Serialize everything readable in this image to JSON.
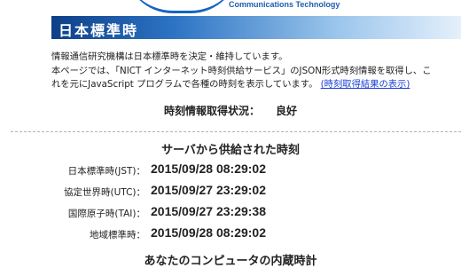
{
  "header": {
    "logo_subtext": "Communications Technology",
    "banner_title": "日本標準時"
  },
  "intro": {
    "line1": "情報通信研究機構は日本標準時を決定・維持しています。",
    "line2": "本ページでは、「NICT インターネット時刻供給サービス」のJSON形式時刻情報を取得し、こ",
    "line3_text": "れを元にJavaScript プログラムで各種の時刻を表示しています。",
    "link_label": "(時刻取得結果の表示)"
  },
  "status": {
    "label": "時刻情報取得状況：",
    "value": "良好"
  },
  "server_section": {
    "title": "サーバから供給された時刻",
    "rows": [
      {
        "label": "日本標準時(JST)：",
        "value": "2015/09/28 08:29:02"
      },
      {
        "label": "協定世界時(UTC)：",
        "value": "2015/09/27 23:29:02"
      },
      {
        "label": "国際原子時(TAI)：",
        "value": "2015/09/27 23:29:38"
      },
      {
        "label": "地域標準時：",
        "value": "2015/09/28 08:29:02"
      }
    ]
  },
  "local_section": {
    "title": "あなたのコンピュータの内蔵時計"
  }
}
